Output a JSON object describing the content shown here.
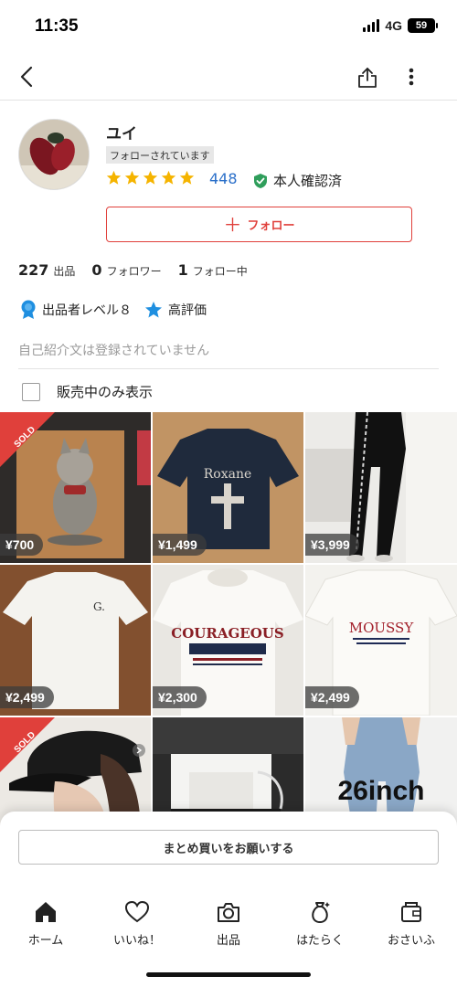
{
  "status_bar": {
    "time": "11:35",
    "network": "4G",
    "battery": "59"
  },
  "nav": {
    "back_icon": "chevron-left-icon",
    "share_icon": "share-icon",
    "more_icon": "more-vertical-icon"
  },
  "profile": {
    "name": "ユイ",
    "follow_status": "フォローされています",
    "rating_stars": 5,
    "rating_count": "448",
    "verified_label": "本人確認済",
    "follow_button": "フォロー"
  },
  "stats": {
    "listings_count": "227",
    "listings_label": "出品",
    "followers_count": "0",
    "followers_label": "フォロワー",
    "following_count": "1",
    "following_label": "フォロー中"
  },
  "badges": {
    "seller_level": "出品者レベル８",
    "high_rating": "高評価"
  },
  "intro_text": "自己紹介文は登録されていません",
  "filter": {
    "label": "販売中のみ表示",
    "checked": false
  },
  "items": [
    {
      "price": "¥700",
      "sold": true,
      "sold_label": "SOLD"
    },
    {
      "price": "¥1,499",
      "sold": false,
      "print_text": "Roxane"
    },
    {
      "price": "¥3,999",
      "sold": false
    },
    {
      "price": "¥2,499",
      "sold": false
    },
    {
      "price": "¥2,300",
      "sold": false,
      "print_text": "COURAGEOUS"
    },
    {
      "price": "¥2,499",
      "sold": false,
      "print_text": "MOUSSY"
    },
    {
      "price": "",
      "sold": true,
      "sold_label": "SOLD"
    },
    {
      "price": "",
      "sold": false
    },
    {
      "price": "",
      "sold": false,
      "overlay_text": "26inch"
    }
  ],
  "bulk_request_button": "まとめ買いをお願いする",
  "tabs": [
    {
      "label": "ホーム",
      "icon": "home-icon"
    },
    {
      "label": "いいね！",
      "icon": "heart-icon"
    },
    {
      "label": "出品",
      "icon": "camera-icon"
    },
    {
      "label": "はたらく",
      "icon": "money-bag-icon"
    },
    {
      "label": "おさいふ",
      "icon": "wallet-icon"
    }
  ],
  "colors": {
    "accent": "#e0403b",
    "link": "#2a6fc9",
    "star": "#f5b400",
    "verified": "#2f9e5b",
    "badge_blue": "#1f8fe0"
  }
}
